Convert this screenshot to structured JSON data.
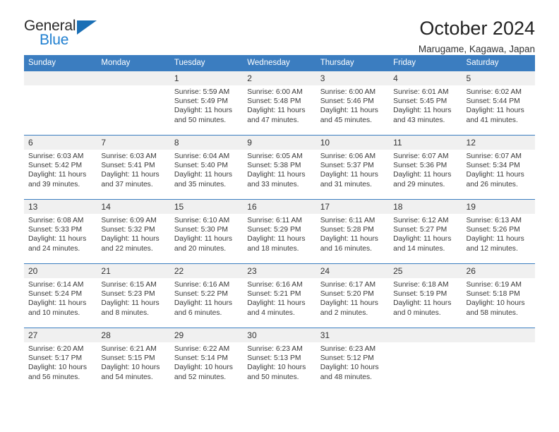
{
  "brand": {
    "name_top": "General",
    "name_bottom": "Blue",
    "accent_color": "#1f7fd0",
    "triangle_color": "#1a6fb5"
  },
  "header": {
    "title": "October 2024",
    "subtitle": "Marugame, Kagawa, Japan"
  },
  "theme": {
    "header_bg": "#3b7dc0",
    "daynum_bg": "#f0f0f0",
    "row_separator": "#3b7dc0",
    "text": "#3a3a3a"
  },
  "weekday_headers": [
    "Sunday",
    "Monday",
    "Tuesday",
    "Wednesday",
    "Thursday",
    "Friday",
    "Saturday"
  ],
  "weeks": [
    [
      {
        "day": "",
        "empty": true
      },
      {
        "day": "",
        "empty": true
      },
      {
        "day": "1",
        "sunrise": "Sunrise: 5:59 AM",
        "sunset": "Sunset: 5:49 PM",
        "daylight_line1": "Daylight: 11 hours",
        "daylight_line2": "and 50 minutes."
      },
      {
        "day": "2",
        "sunrise": "Sunrise: 6:00 AM",
        "sunset": "Sunset: 5:48 PM",
        "daylight_line1": "Daylight: 11 hours",
        "daylight_line2": "and 47 minutes."
      },
      {
        "day": "3",
        "sunrise": "Sunrise: 6:00 AM",
        "sunset": "Sunset: 5:46 PM",
        "daylight_line1": "Daylight: 11 hours",
        "daylight_line2": "and 45 minutes."
      },
      {
        "day": "4",
        "sunrise": "Sunrise: 6:01 AM",
        "sunset": "Sunset: 5:45 PM",
        "daylight_line1": "Daylight: 11 hours",
        "daylight_line2": "and 43 minutes."
      },
      {
        "day": "5",
        "sunrise": "Sunrise: 6:02 AM",
        "sunset": "Sunset: 5:44 PM",
        "daylight_line1": "Daylight: 11 hours",
        "daylight_line2": "and 41 minutes."
      }
    ],
    [
      {
        "day": "6",
        "sunrise": "Sunrise: 6:03 AM",
        "sunset": "Sunset: 5:42 PM",
        "daylight_line1": "Daylight: 11 hours",
        "daylight_line2": "and 39 minutes."
      },
      {
        "day": "7",
        "sunrise": "Sunrise: 6:03 AM",
        "sunset": "Sunset: 5:41 PM",
        "daylight_line1": "Daylight: 11 hours",
        "daylight_line2": "and 37 minutes."
      },
      {
        "day": "8",
        "sunrise": "Sunrise: 6:04 AM",
        "sunset": "Sunset: 5:40 PM",
        "daylight_line1": "Daylight: 11 hours",
        "daylight_line2": "and 35 minutes."
      },
      {
        "day": "9",
        "sunrise": "Sunrise: 6:05 AM",
        "sunset": "Sunset: 5:38 PM",
        "daylight_line1": "Daylight: 11 hours",
        "daylight_line2": "and 33 minutes."
      },
      {
        "day": "10",
        "sunrise": "Sunrise: 6:06 AM",
        "sunset": "Sunset: 5:37 PM",
        "daylight_line1": "Daylight: 11 hours",
        "daylight_line2": "and 31 minutes."
      },
      {
        "day": "11",
        "sunrise": "Sunrise: 6:07 AM",
        "sunset": "Sunset: 5:36 PM",
        "daylight_line1": "Daylight: 11 hours",
        "daylight_line2": "and 29 minutes."
      },
      {
        "day": "12",
        "sunrise": "Sunrise: 6:07 AM",
        "sunset": "Sunset: 5:34 PM",
        "daylight_line1": "Daylight: 11 hours",
        "daylight_line2": "and 26 minutes."
      }
    ],
    [
      {
        "day": "13",
        "sunrise": "Sunrise: 6:08 AM",
        "sunset": "Sunset: 5:33 PM",
        "daylight_line1": "Daylight: 11 hours",
        "daylight_line2": "and 24 minutes."
      },
      {
        "day": "14",
        "sunrise": "Sunrise: 6:09 AM",
        "sunset": "Sunset: 5:32 PM",
        "daylight_line1": "Daylight: 11 hours",
        "daylight_line2": "and 22 minutes."
      },
      {
        "day": "15",
        "sunrise": "Sunrise: 6:10 AM",
        "sunset": "Sunset: 5:30 PM",
        "daylight_line1": "Daylight: 11 hours",
        "daylight_line2": "and 20 minutes."
      },
      {
        "day": "16",
        "sunrise": "Sunrise: 6:11 AM",
        "sunset": "Sunset: 5:29 PM",
        "daylight_line1": "Daylight: 11 hours",
        "daylight_line2": "and 18 minutes."
      },
      {
        "day": "17",
        "sunrise": "Sunrise: 6:11 AM",
        "sunset": "Sunset: 5:28 PM",
        "daylight_line1": "Daylight: 11 hours",
        "daylight_line2": "and 16 minutes."
      },
      {
        "day": "18",
        "sunrise": "Sunrise: 6:12 AM",
        "sunset": "Sunset: 5:27 PM",
        "daylight_line1": "Daylight: 11 hours",
        "daylight_line2": "and 14 minutes."
      },
      {
        "day": "19",
        "sunrise": "Sunrise: 6:13 AM",
        "sunset": "Sunset: 5:26 PM",
        "daylight_line1": "Daylight: 11 hours",
        "daylight_line2": "and 12 minutes."
      }
    ],
    [
      {
        "day": "20",
        "sunrise": "Sunrise: 6:14 AM",
        "sunset": "Sunset: 5:24 PM",
        "daylight_line1": "Daylight: 11 hours",
        "daylight_line2": "and 10 minutes."
      },
      {
        "day": "21",
        "sunrise": "Sunrise: 6:15 AM",
        "sunset": "Sunset: 5:23 PM",
        "daylight_line1": "Daylight: 11 hours",
        "daylight_line2": "and 8 minutes."
      },
      {
        "day": "22",
        "sunrise": "Sunrise: 6:16 AM",
        "sunset": "Sunset: 5:22 PM",
        "daylight_line1": "Daylight: 11 hours",
        "daylight_line2": "and 6 minutes."
      },
      {
        "day": "23",
        "sunrise": "Sunrise: 6:16 AM",
        "sunset": "Sunset: 5:21 PM",
        "daylight_line1": "Daylight: 11 hours",
        "daylight_line2": "and 4 minutes."
      },
      {
        "day": "24",
        "sunrise": "Sunrise: 6:17 AM",
        "sunset": "Sunset: 5:20 PM",
        "daylight_line1": "Daylight: 11 hours",
        "daylight_line2": "and 2 minutes."
      },
      {
        "day": "25",
        "sunrise": "Sunrise: 6:18 AM",
        "sunset": "Sunset: 5:19 PM",
        "daylight_line1": "Daylight: 11 hours",
        "daylight_line2": "and 0 minutes."
      },
      {
        "day": "26",
        "sunrise": "Sunrise: 6:19 AM",
        "sunset": "Sunset: 5:18 PM",
        "daylight_line1": "Daylight: 10 hours",
        "daylight_line2": "and 58 minutes."
      }
    ],
    [
      {
        "day": "27",
        "sunrise": "Sunrise: 6:20 AM",
        "sunset": "Sunset: 5:17 PM",
        "daylight_line1": "Daylight: 10 hours",
        "daylight_line2": "and 56 minutes."
      },
      {
        "day": "28",
        "sunrise": "Sunrise: 6:21 AM",
        "sunset": "Sunset: 5:15 PM",
        "daylight_line1": "Daylight: 10 hours",
        "daylight_line2": "and 54 minutes."
      },
      {
        "day": "29",
        "sunrise": "Sunrise: 6:22 AM",
        "sunset": "Sunset: 5:14 PM",
        "daylight_line1": "Daylight: 10 hours",
        "daylight_line2": "and 52 minutes."
      },
      {
        "day": "30",
        "sunrise": "Sunrise: 6:23 AM",
        "sunset": "Sunset: 5:13 PM",
        "daylight_line1": "Daylight: 10 hours",
        "daylight_line2": "and 50 minutes."
      },
      {
        "day": "31",
        "sunrise": "Sunrise: 6:23 AM",
        "sunset": "Sunset: 5:12 PM",
        "daylight_line1": "Daylight: 10 hours",
        "daylight_line2": "and 48 minutes."
      },
      {
        "day": "",
        "empty": true
      },
      {
        "day": "",
        "empty": true
      }
    ]
  ]
}
